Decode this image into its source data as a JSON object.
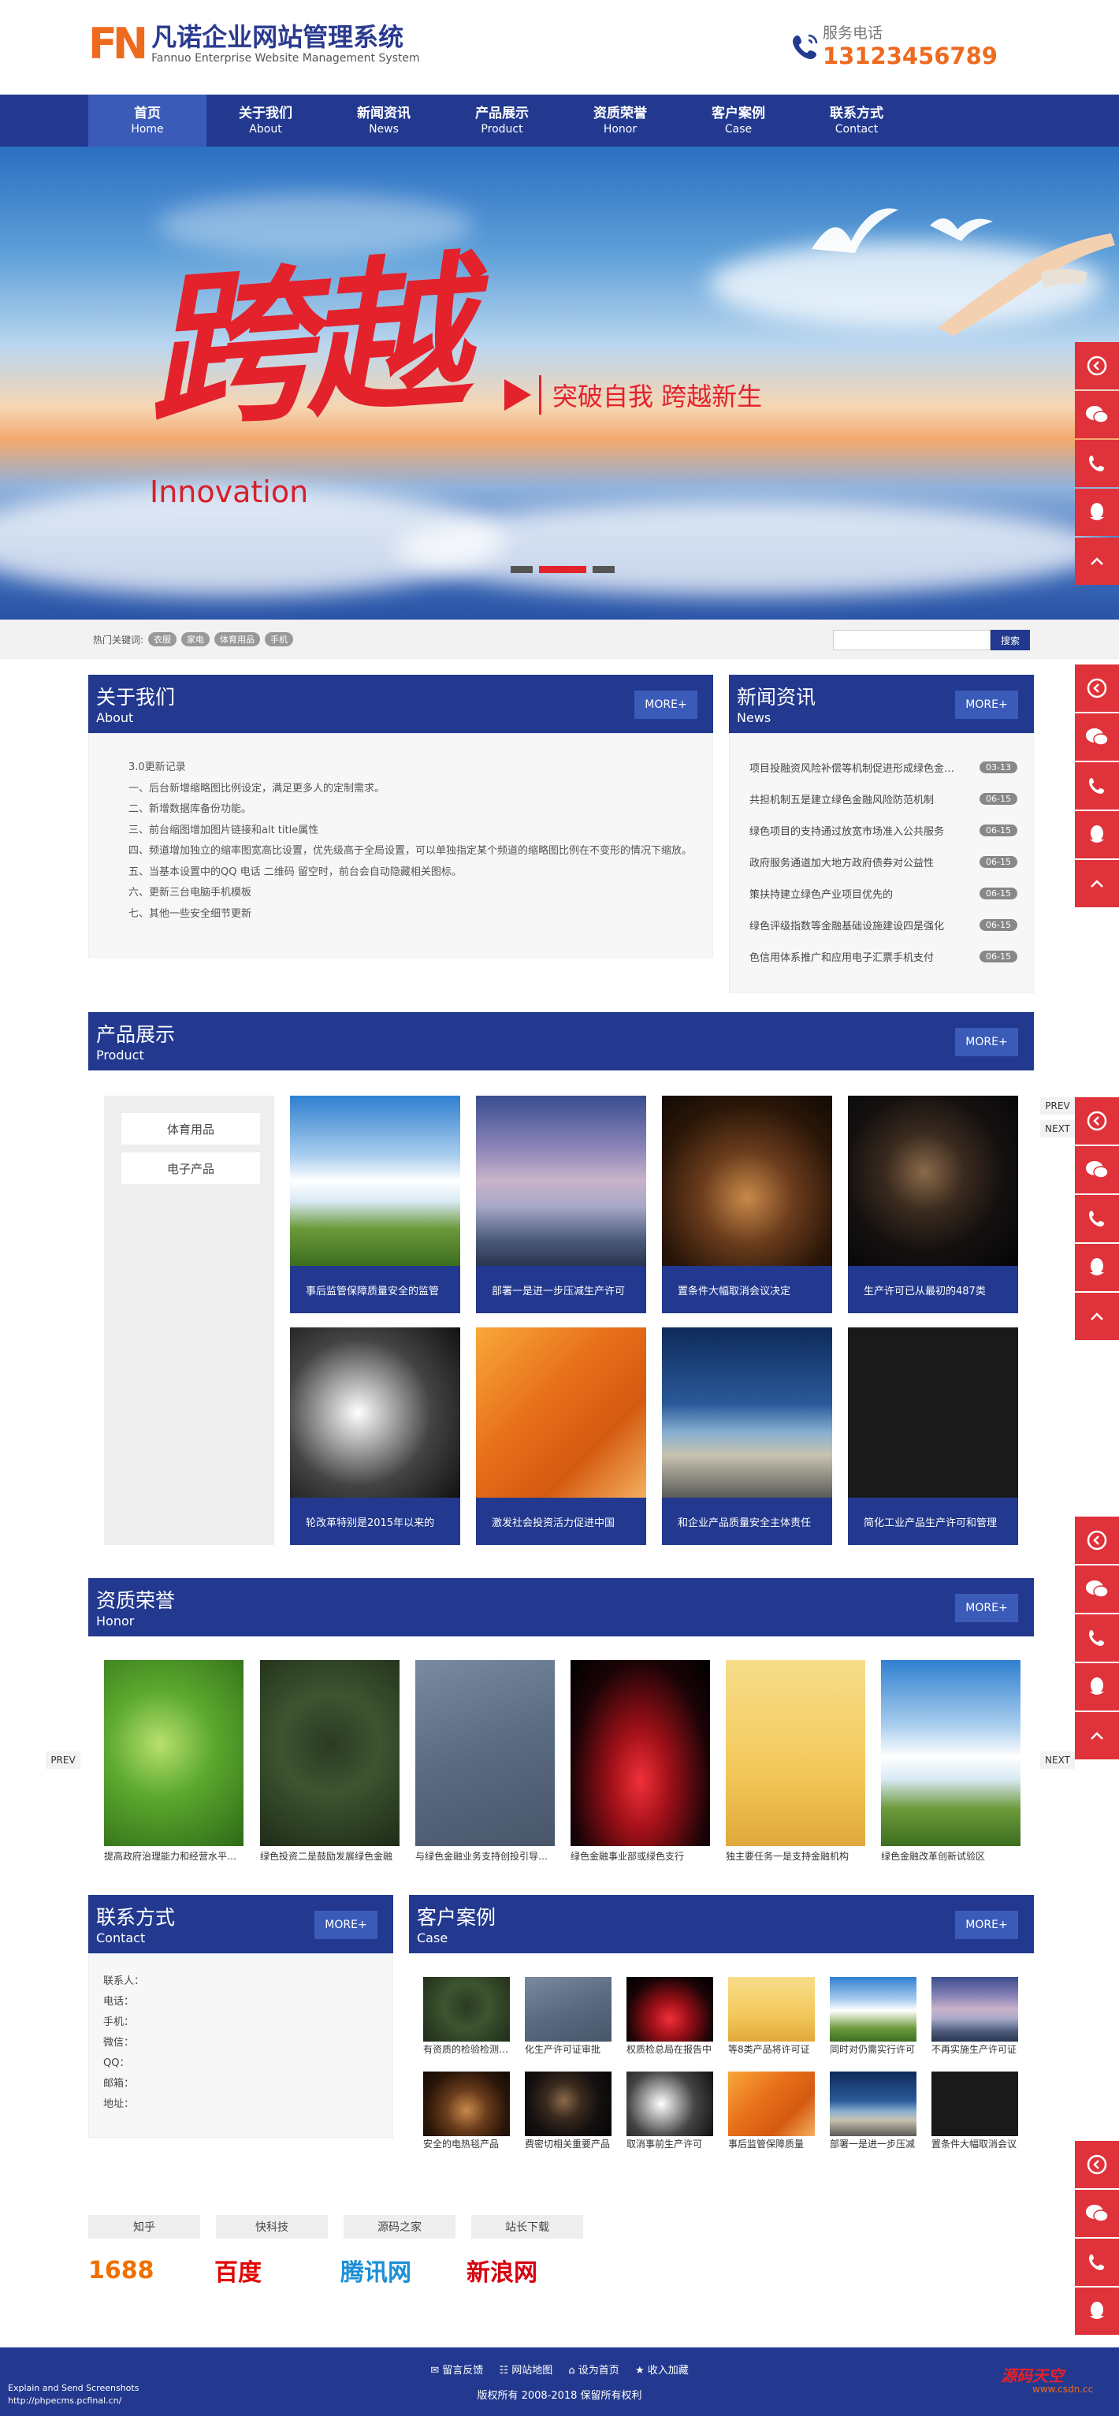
{
  "header": {
    "logo_mark": "FN",
    "logo_cn": "凡诺企业网站管理系统",
    "logo_en": "Fannuo Enterprise Website Management System",
    "phone_label": "服务电话",
    "phone_number": "13123456789"
  },
  "nav": [
    {
      "cn": "首页",
      "en": "Home"
    },
    {
      "cn": "关于我们",
      "en": "About"
    },
    {
      "cn": "新闻资讯",
      "en": "News"
    },
    {
      "cn": "产品展示",
      "en": "Product"
    },
    {
      "cn": "资质荣誉",
      "en": "Honor"
    },
    {
      "cn": "客户案例",
      "en": "Case"
    },
    {
      "cn": "联系方式",
      "en": "Contact"
    }
  ],
  "banner": {
    "title": "跨越",
    "en": "Innovation",
    "slogan": "突破自我  跨越新生"
  },
  "search": {
    "hot_label": "热门关键词:",
    "tags": [
      "衣服",
      "家电",
      "体育用品",
      "手机"
    ],
    "placeholder": "",
    "button": "搜索"
  },
  "more_label": "MORE+",
  "about": {
    "cn": "关于我们",
    "en": "About",
    "lines": [
      "3.0更新记录",
      "一、后台新增缩略图比例设定，满足更多人的定制需求。",
      "二、新增数据库备份功能。",
      "三、前台缩图增加图片链接和alt title属性",
      "四、频道增加独立的缩率图宽高比设置，优先级高于全局设置，可以单独指定某个频道的缩略图比例在不变形的情况下缩放。",
      "五、当基本设置中的QQ 电话 二维码 留空时，前台会自动隐藏相关图标。",
      "六、更新三台电脑手机模板",
      "七、其他一些安全细节更新"
    ]
  },
  "news": {
    "cn": "新闻资讯",
    "en": "News",
    "items": [
      {
        "title": "项目投融资风险补偿等机制促进形成绿色金融服务",
        "date": "03-13"
      },
      {
        "title": "共担机制五是建立绿色金融风险防范机制",
        "date": "06-15"
      },
      {
        "title": "绿色项目的支持通过放宽市场准入公共服务",
        "date": "06-15"
      },
      {
        "title": "政府服务通道加大地方政府债券对公益性",
        "date": "06-15"
      },
      {
        "title": "策扶持建立绿色产业项目优先的",
        "date": "06-15"
      },
      {
        "title": "绿色评级指数等金融基础设施建设四是强化",
        "date": "06-15"
      },
      {
        "title": "色信用体系推广和应用电子汇票手机支付",
        "date": "06-15"
      }
    ]
  },
  "product": {
    "cn": "产品展示",
    "en": "Product",
    "categories": [
      "体育用品",
      "电子产品"
    ],
    "prev": "PREV",
    "next": "NEXT",
    "items": [
      {
        "title": "事后监管保障质量安全的监管"
      },
      {
        "title": "部署一是进一步压减生产许可"
      },
      {
        "title": "置条件大幅取消会议决定"
      },
      {
        "title": "生产许可已从最初的487类"
      },
      {
        "title": "轮改革特别是2015年以来的"
      },
      {
        "title": "激发社会投资活力促进中国"
      },
      {
        "title": "和企业产品质量安全主体责任"
      },
      {
        "title": "简化工业产品生产许可和管理"
      }
    ]
  },
  "honor": {
    "cn": "资质荣誉",
    "en": "Honor",
    "prev": "PREV",
    "next": "NEXT",
    "items": [
      {
        "title": "提高政府治理能力和经营水平的重要举措"
      },
      {
        "title": "绿色投资二是鼓励发展绿色金融"
      },
      {
        "title": "与绿色金融业务支持创投引导基金"
      },
      {
        "title": "绿色金融事业部或绿色支行"
      },
      {
        "title": "独主要任务一是支持金融机构"
      },
      {
        "title": "绿色金融改革创新试验区"
      }
    ]
  },
  "contact": {
    "cn": "联系方式",
    "en": "Contact",
    "fields": [
      "联系人：",
      "电话：",
      "手机：",
      "微信：",
      "QQ：",
      "邮箱：",
      "地址："
    ]
  },
  "cases": {
    "cn": "客户案例",
    "en": "Case",
    "items": [
      {
        "title": "有资质的检验检测机构"
      },
      {
        "title": "化生产许可证审批"
      },
      {
        "title": "权质检总局在报告中"
      },
      {
        "title": "等8类产品将许可证"
      },
      {
        "title": "同时对仍需实行许可"
      },
      {
        "title": "不再实施生产许可证"
      },
      {
        "title": "安全的电热毯产品"
      },
      {
        "title": "费密切相关重要产品"
      },
      {
        "title": "取消事前生产许可"
      },
      {
        "title": "事后监管保障质量"
      },
      {
        "title": "部署一是进一步压减"
      },
      {
        "title": "置条件大幅取消会议"
      }
    ]
  },
  "links": [
    "知乎",
    "快科技",
    "源码之家",
    "站长下载"
  ],
  "partners": [
    "1688",
    "百度",
    "腾讯网",
    "新浪网"
  ],
  "footer": {
    "links": [
      "留言反馈",
      "网站地图",
      "设为首页",
      "收入加藏"
    ],
    "copyright": "版权所有 2008-2018 保留所有权利",
    "shot_note_1": "Explain and Send Screenshots",
    "shot_note_2": "http://phpecms.pcfinal.cn/",
    "watermark": "源码天空",
    "watermark_sub": "www.csdn.cc"
  },
  "colors": {
    "primary": "#22398f",
    "accent": "#ee6a1f",
    "red": "#e0323a"
  }
}
